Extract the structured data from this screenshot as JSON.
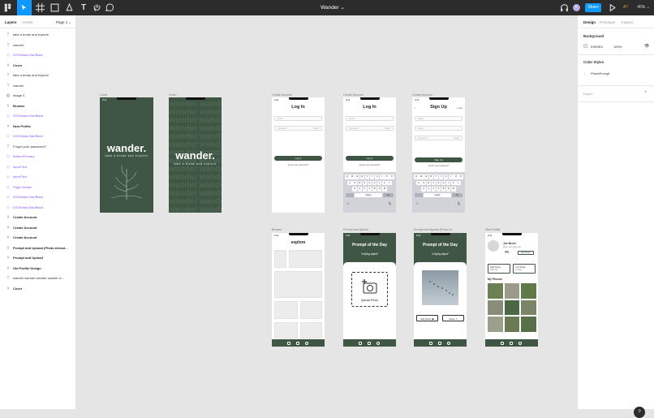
{
  "app": {
    "title": "Wander",
    "share": "Share",
    "avatar_initial": "K",
    "zoom": "45%",
    "play_label": "A?",
    "help": "?"
  },
  "left": {
    "tabs": [
      "Layers",
      "Assets"
    ],
    "page": "Page 1",
    "layers": [
      {
        "type": "text",
        "label": "take a break and explore"
      },
      {
        "type": "text",
        "label": "wander."
      },
      {
        "type": "comp",
        "label": "iOS/Status Bar/Black"
      },
      {
        "type": "frame",
        "label": "Cover"
      },
      {
        "type": "text",
        "label": "take a break and explore"
      },
      {
        "type": "text",
        "label": "wander"
      },
      {
        "type": "image",
        "label": "image 3"
      },
      {
        "type": "frame",
        "label": "Browse"
      },
      {
        "type": "comp",
        "label": "iOS/Status Bar/Black"
      },
      {
        "type": "frame",
        "label": "New Profile"
      },
      {
        "type": "comp",
        "label": "iOS/Status Bar/Black"
      },
      {
        "type": "text",
        "label": "Forgot your password?"
      },
      {
        "type": "comp",
        "label": "Button/Primary"
      },
      {
        "type": "comp",
        "label": "Input/Text"
      },
      {
        "type": "comp",
        "label": "Input/Text"
      },
      {
        "type": "comp",
        "label": "Page Header"
      },
      {
        "type": "comp",
        "label": "iOS/Status Bar/Black"
      },
      {
        "type": "comp",
        "label": "iOS/Status Bar/Black"
      },
      {
        "type": "frame",
        "label": "Create Account"
      },
      {
        "type": "frame",
        "label": "Create Account"
      },
      {
        "type": "frame",
        "label": "Create Account"
      },
      {
        "type": "frame",
        "label": "Prompt and Upload (Photo Alread..."
      },
      {
        "type": "frame",
        "label": "Prompt and Upload"
      },
      {
        "type": "frame",
        "label": "Old Profile Design"
      },
      {
        "type": "text",
        "label": "wander wander wander wander w..."
      },
      {
        "type": "frame",
        "label": "Cover"
      }
    ]
  },
  "right": {
    "tabs": [
      "Design",
      "Prototype",
      "Inspect"
    ],
    "background_label": "Background",
    "bg_hex": "E5E5E5",
    "bg_opacity": "100%",
    "color_styles_label": "Color Styles",
    "style_name": "PhotoPrompt",
    "export_label": "Export"
  },
  "frames": {
    "cover1": {
      "label": "Cover",
      "title": "wander.",
      "tagline": "take a break and explore"
    },
    "cover2": {
      "label": "Cover",
      "title": "wander.",
      "tagline": "take a break and explore",
      "bg_word": "wander"
    },
    "login1": {
      "label": "Create Account",
      "title": "Log In",
      "email": "Email",
      "password": "Password",
      "show": "Show",
      "button": "Log In",
      "forgot": "Forgot your password?"
    },
    "login2": {
      "label": "Create Account",
      "title": "Log In",
      "email": "Email",
      "password": "Password",
      "show": "Show",
      "button": "Log In",
      "forgot": "Forgot your password?",
      "space": "space",
      "go": "Go"
    },
    "signup": {
      "label": "Create Account",
      "title": "Sign Up",
      "login_link": "Login",
      "name": "Name",
      "email": "Email",
      "password": "Password",
      "show": "Show",
      "button": "Sign Up",
      "forgot": "Forgot your password?",
      "space": "space",
      "go": "Go"
    },
    "browse": {
      "label": "Browse",
      "title": "explore"
    },
    "prompt": {
      "label": "Prompt and Upload",
      "title": "Prompt of the Day",
      "topic": "\"a flying object\"",
      "upload": "Upload Photo"
    },
    "prompt_done": {
      "label": "Prompt and Upload (Photo Al...",
      "title": "Prompt of the Day",
      "topic": "\"a flying object\"",
      "edit": "Edit Photo",
      "share": "Share"
    },
    "profile": {
      "label": "New Profile",
      "name": "Joe Bruin",
      "bio": "sleep, eat, pray, love",
      "count": "408",
      "count_label": "photos",
      "edit": "Edit Profile",
      "card1": "Past Photos",
      "card1_sub": "138 total",
      "card2": "Your Streak",
      "card2_sub": "24 days",
      "section": "My Photos"
    }
  },
  "keyboard": {
    "rows": [
      "QWERTYUIOP",
      "ASDFGHJKL",
      "ZXCVBNM"
    ]
  },
  "status_time": "9:41"
}
